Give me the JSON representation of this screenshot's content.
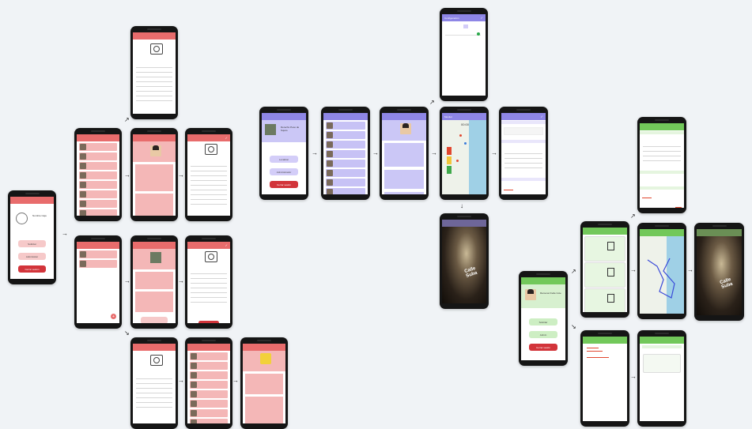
{
  "screens": {
    "intro_name": "Nombre Caja",
    "intro_btn1": "Solicitar",
    "intro_btn2": "Administrar",
    "intro_btn3": "Cerrar sesión",
    "purple_intro_name": "Derecho Peso de Sujeto",
    "purple_btn1": "Localizar",
    "purple_btn2": "Administrador",
    "purple_btn3": "Cerrar sesión",
    "green_intro_name": "Ramona Frelle Cole",
    "green_btn1": "Solicitar",
    "green_btn2": "Admin",
    "green_btn3": "Cerrar sesión",
    "map_title": "Monitor",
    "map_time": "00:00",
    "tunnel_text": "Calle Suba",
    "settings_title": "Configuración"
  },
  "colors": {
    "red": "#e86c6c",
    "purple": "#8e86e6",
    "green": "#72c85a",
    "danger": "#d2343a"
  },
  "icons": [
    "camera-icon",
    "avatar-icon",
    "check-icon",
    "plus-icon",
    "arrow-right-icon"
  ]
}
